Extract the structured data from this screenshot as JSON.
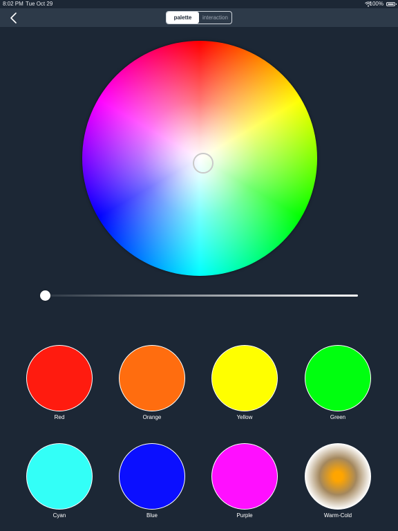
{
  "status_bar": {
    "time": "8:02 PM",
    "date": "Tue Oct 29",
    "battery": "100%"
  },
  "nav": {
    "tabs": [
      {
        "label": "palette",
        "selected": true
      },
      {
        "label": "interaction",
        "selected": false
      }
    ]
  },
  "brightness": 0,
  "presets": [
    {
      "label": "Red",
      "color": "#ff1b0f"
    },
    {
      "label": "Orange",
      "color": "#ff6d0f"
    },
    {
      "label": "Yellow",
      "color": "#ffff00"
    },
    {
      "label": "Green",
      "color": "#00ff0f"
    },
    {
      "label": "Cyan",
      "color": "#33fff7"
    },
    {
      "label": "Blue",
      "color": "#0b0fff"
    },
    {
      "label": "Purple",
      "color": "#ff0fff"
    },
    {
      "label": "Warm-Cold",
      "color": "#ffa500"
    }
  ]
}
